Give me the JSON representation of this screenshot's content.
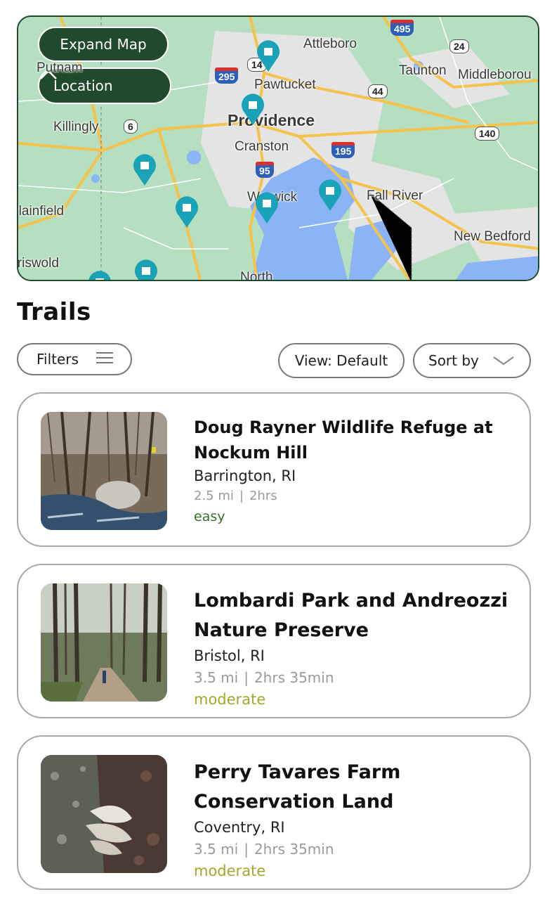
{
  "map": {
    "expand_label": "Expand Map",
    "location_label": "Location",
    "places": [
      {
        "name": "Attleboro",
        "big": false
      },
      {
        "name": "Pawtucket",
        "big": false
      },
      {
        "name": "Providence",
        "big": true
      },
      {
        "name": "Cranston",
        "big": false
      },
      {
        "name": "Taunton",
        "big": false
      },
      {
        "name": "Middleborou",
        "big": false
      },
      {
        "name": "Killingly",
        "big": false
      },
      {
        "name": "Putnam",
        "big": false
      },
      {
        "name": "Plainfield",
        "big": false
      },
      {
        "name": "Warwick",
        "big": false
      },
      {
        "name": "Fall River",
        "big": false
      },
      {
        "name": "New Bedford",
        "big": false
      },
      {
        "name": "Griswold",
        "big": false
      },
      {
        "name": "North",
        "big": false
      }
    ],
    "shields": [
      "495",
      "295",
      "24",
      "44",
      "14",
      "6",
      "140",
      "195",
      "95"
    ]
  },
  "page_title": "Trails",
  "controls": {
    "filters_label": "Filters",
    "view_label": "View: Default",
    "sort_label": "Sort by"
  },
  "colors": {
    "easy": "#3d6b2e",
    "moderate": "#a3a829",
    "accent": "#1f4a2c",
    "pin": "#1aa3b8"
  },
  "trails": [
    {
      "title": "Doug Rayner Wildlife Refuge at Nockum Hill",
      "location": "Barrington, RI",
      "distance": "2.5 mi",
      "separator": "|",
      "duration": "2hrs",
      "difficulty": "easy"
    },
    {
      "title": "Lombardi Park and Andreozzi Nature Preserve",
      "location": "Bristol, RI",
      "distance": "3.5 mi",
      "separator": "|",
      "duration": "2hrs 35min",
      "difficulty": "moderate"
    },
    {
      "title": "Perry Tavares Farm Conservation Land",
      "location": "Coventry, RI",
      "distance": "3.5 mi",
      "separator": "|",
      "duration": "2hrs 35min",
      "difficulty": "moderate"
    }
  ]
}
